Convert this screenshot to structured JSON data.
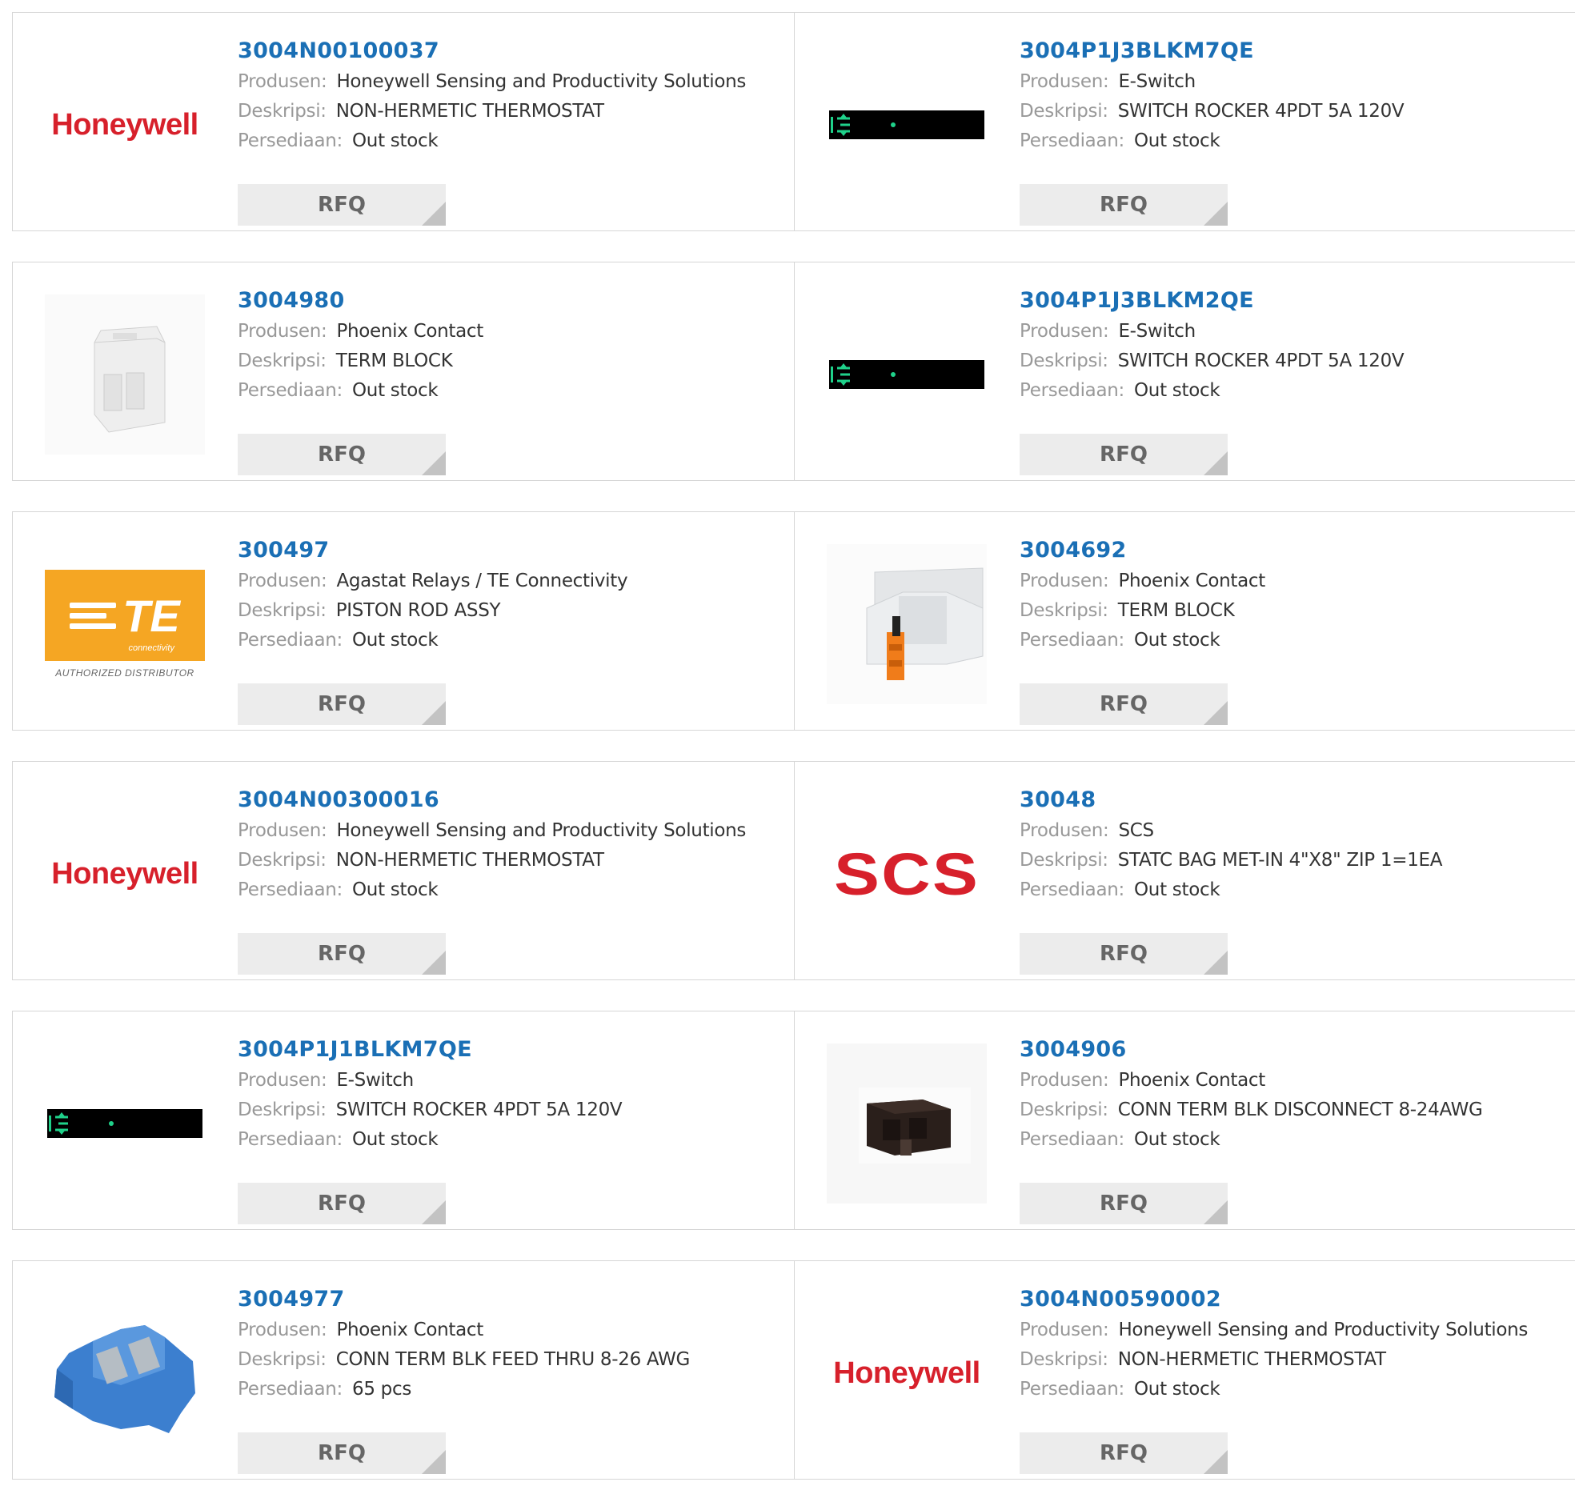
{
  "labels": {
    "manufacturer": "Produsen:",
    "description": "Deskripsi:",
    "stock": "Persediaan:",
    "rfq": "RFQ"
  },
  "colors": {
    "part_link": "#1a6fb5",
    "honeywell_red": "#d7202b",
    "te_orange": "#f5a623",
    "rfq_bg": "#ececec"
  },
  "products": [
    {
      "part": "3004N00100037",
      "manufacturer": "Honeywell Sensing and Productivity Solutions",
      "description": "NON-HERMETIC THERMOSTAT",
      "stock": "Out stock",
      "logo": "honeywell-logo",
      "logo_text": "Honeywell"
    },
    {
      "part": "3004P1J3BLKM7QE",
      "manufacturer": "E-Switch",
      "description": "SWITCH ROCKER 4PDT 5A 120V",
      "stock": "Out stock",
      "logo": "rocker-switch-image"
    },
    {
      "part": "3004980",
      "manufacturer": "Phoenix Contact",
      "description": "TERM BLOCK",
      "stock": "Out stock",
      "logo": "terminal-block-image"
    },
    {
      "part": "3004P1J3BLKM2QE",
      "manufacturer": "E-Switch",
      "description": "SWITCH ROCKER 4PDT 5A 120V",
      "stock": "Out stock",
      "logo": "rocker-switch-image"
    },
    {
      "part": "300497",
      "manufacturer": "Agastat Relays / TE Connectivity",
      "description": "PISTON ROD ASSY",
      "stock": "Out stock",
      "logo": "te-connectivity-logo",
      "logo_text": "TE",
      "logo_subtext": "connectivity",
      "logo_caption": "AUTHORIZED DISTRIBUTOR"
    },
    {
      "part": "3004692",
      "manufacturer": "Phoenix Contact",
      "description": "TERM BLOCK",
      "stock": "Out stock",
      "logo": "terminal-block-orange-image"
    },
    {
      "part": "3004N00300016",
      "manufacturer": "Honeywell Sensing and Productivity Solutions",
      "description": "NON-HERMETIC THERMOSTAT",
      "stock": "Out stock",
      "logo": "honeywell-logo",
      "logo_text": "Honeywell"
    },
    {
      "part": "30048",
      "manufacturer": "SCS",
      "description": "STATC BAG MET-IN 4\"X8\" ZIP 1=1EA",
      "stock": "Out stock",
      "logo": "scs-logo",
      "logo_text": "SCS"
    },
    {
      "part": "3004P1J1BLKM7QE",
      "manufacturer": "E-Switch",
      "description": "SWITCH ROCKER 4PDT 5A 120V",
      "stock": "Out stock",
      "logo": "rocker-switch-image"
    },
    {
      "part": "3004906",
      "manufacturer": "Phoenix Contact",
      "description": "CONN TERM BLK DISCONNECT 8-24AWG",
      "stock": "Out stock",
      "logo": "terminal-block-black-image"
    },
    {
      "part": "3004977",
      "manufacturer": "Phoenix Contact",
      "description": "CONN TERM BLK FEED THRU 8-26 AWG",
      "stock": "65 pcs",
      "logo": "terminal-block-blue-image"
    },
    {
      "part": "3004N00590002",
      "manufacturer": "Honeywell Sensing and Productivity Solutions",
      "description": "NON-HERMETIC THERMOSTAT",
      "stock": "Out stock",
      "logo": "honeywell-logo",
      "logo_text": "Honeywell"
    }
  ]
}
